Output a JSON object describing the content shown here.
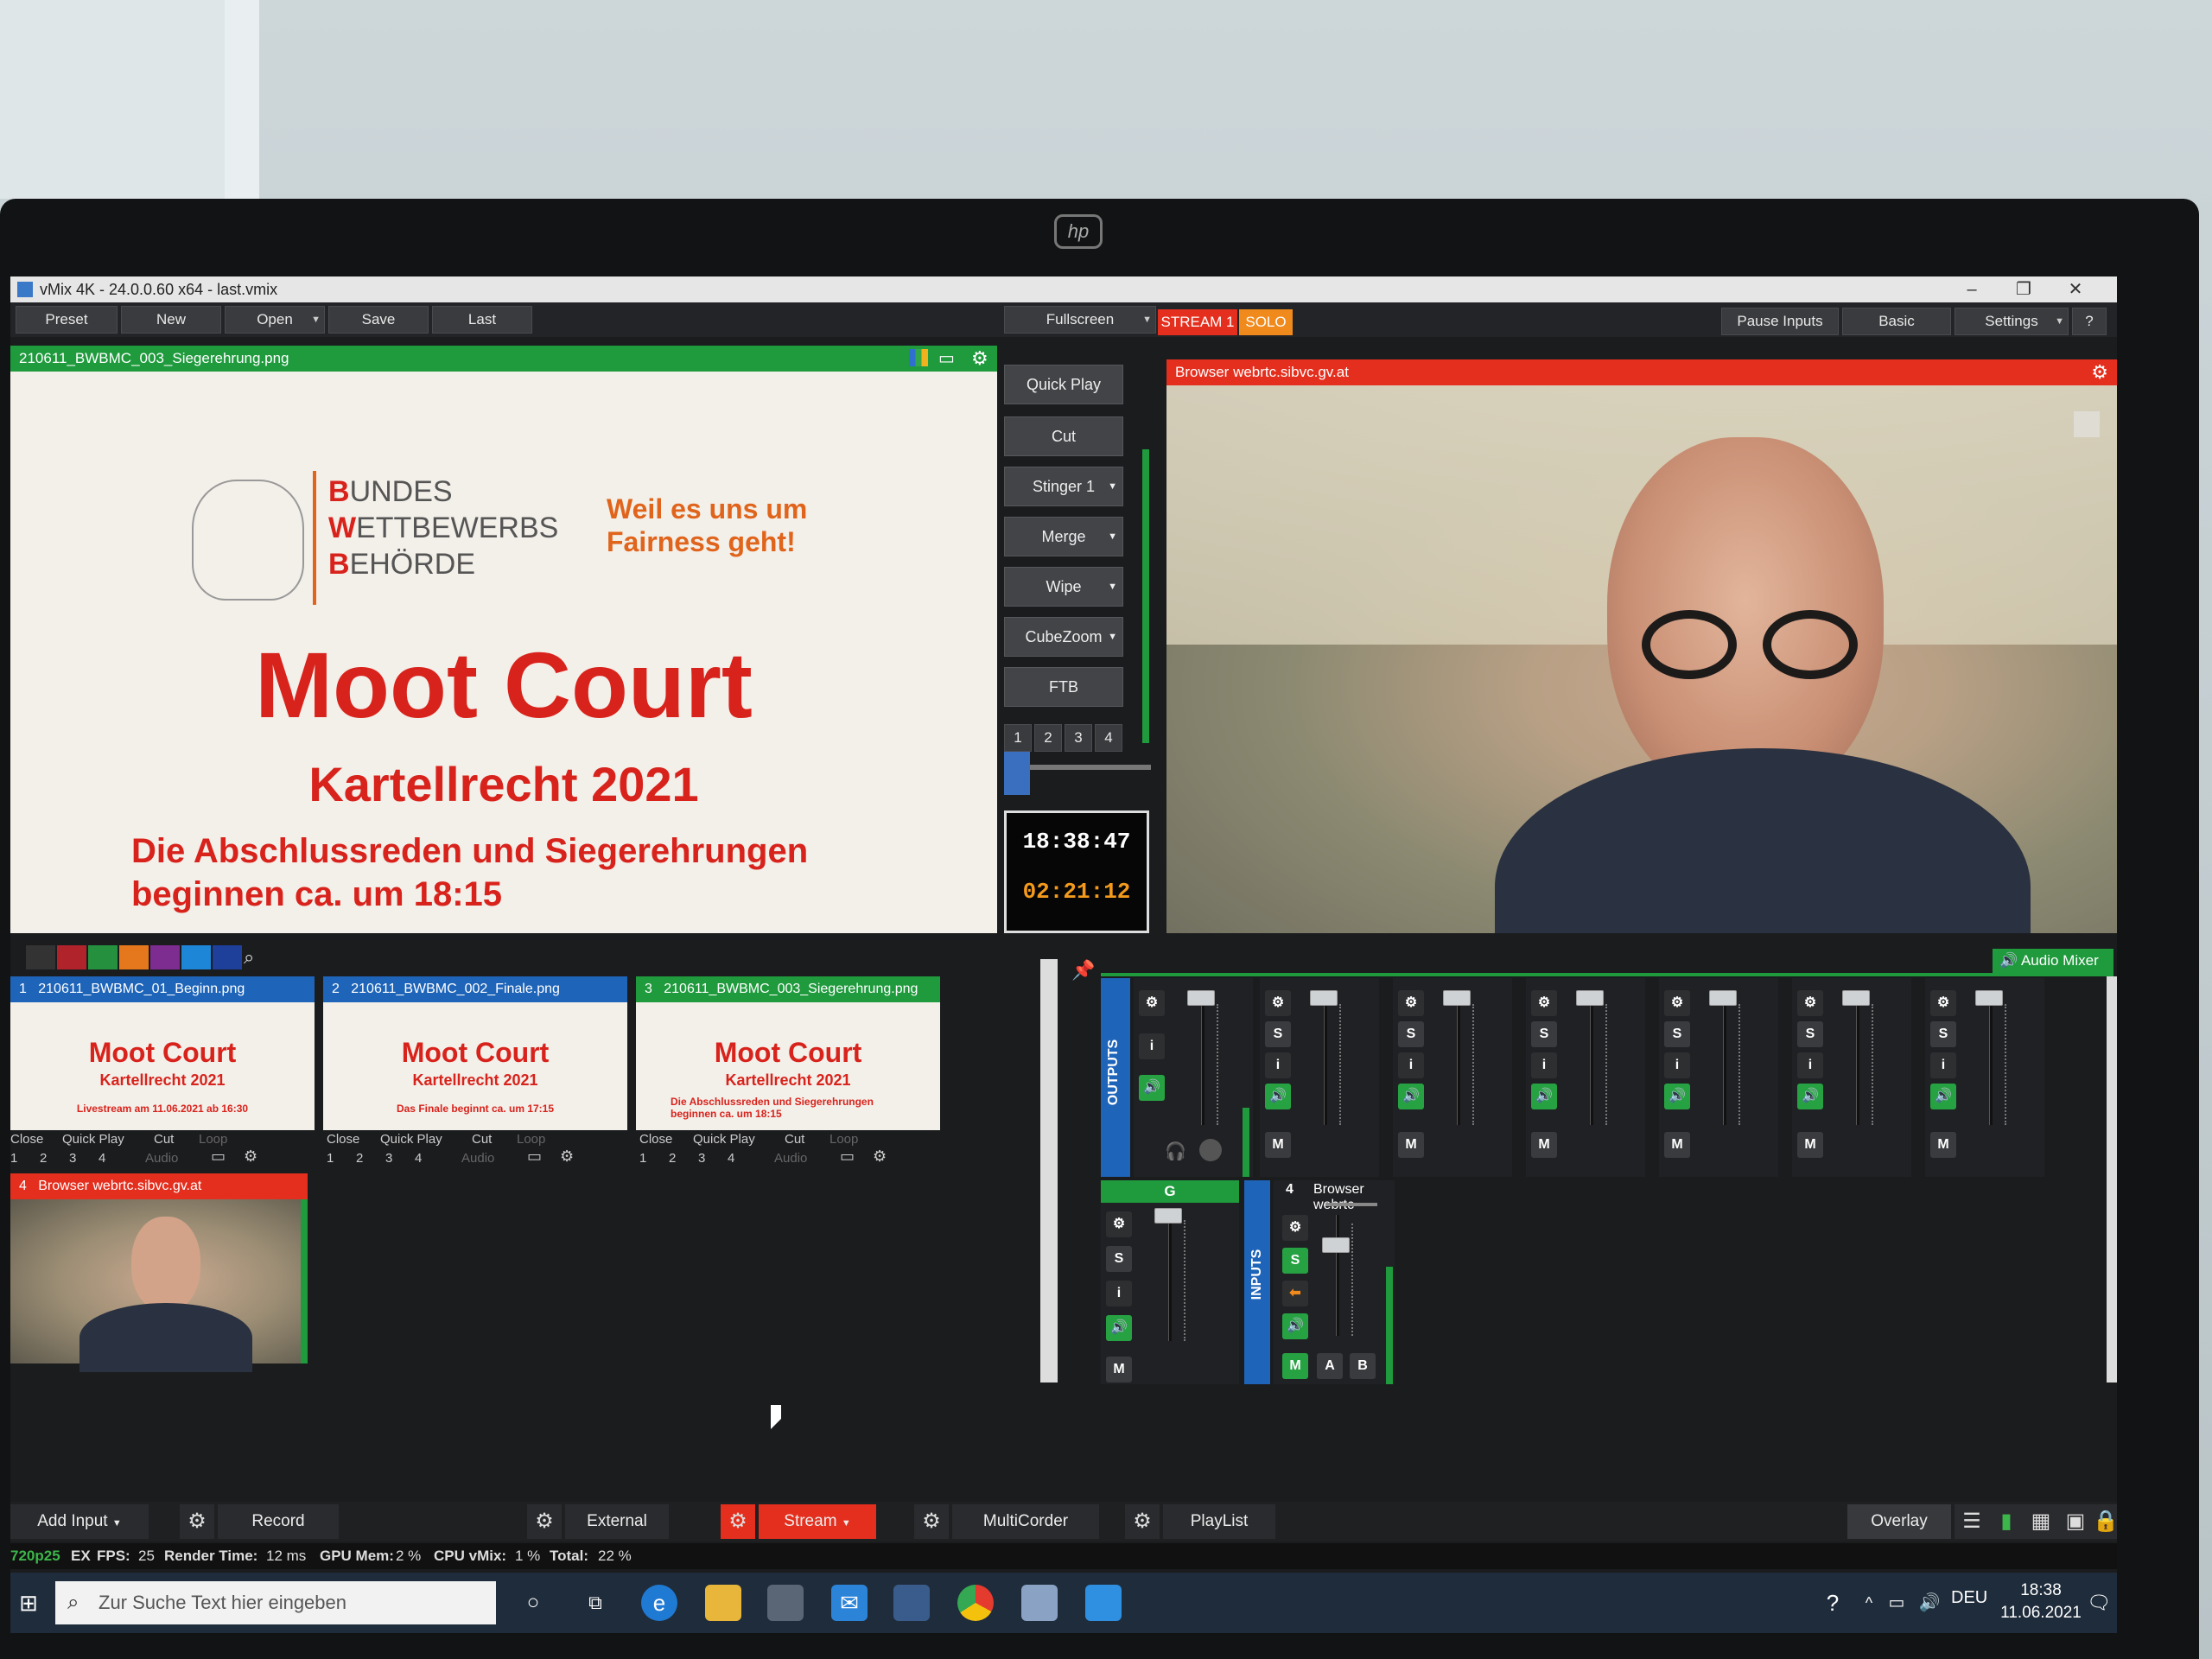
{
  "window": {
    "title": "vMix 4K - 24.0.0.60 x64 - last.vmix"
  },
  "menu": {
    "preset": "Preset",
    "new": "New",
    "open": "Open",
    "save": "Save",
    "last": "Last"
  },
  "top_right": {
    "fullscreen": "Fullscreen",
    "stream": "STREAM 1",
    "solo": "SOLO",
    "pause_inputs": "Pause Inputs",
    "basic": "Basic",
    "settings": "Settings",
    "help": "?"
  },
  "preview": {
    "header": "210611_BWBMC_003_Siegerehrung.png",
    "logo_lines": [
      "B",
      "UNDES",
      "W",
      "ETTBEWERBS",
      "B",
      "EHÖRDE"
    ],
    "slogan_line1": "Weil es uns um",
    "slogan_line2": "Fairness geht!",
    "title": "Moot Court",
    "subtitle": "Kartellrecht 2021",
    "line1": "Die Abschlussreden und Siegerehrungen",
    "line2": "beginnen ca. um 18:15"
  },
  "output": {
    "header": "Browser webrtc.sibvc.gv.at"
  },
  "transitions": {
    "quick_play": "Quick Play",
    "cut": "Cut",
    "stinger": "Stinger 1",
    "merge": "Merge",
    "wipe": "Wipe",
    "cubezoom": "CubeZoom",
    "ftb": "FTB",
    "numbers": [
      "1",
      "2",
      "3",
      "4"
    ],
    "clock": "18:38:47",
    "duration": "02:21:12"
  },
  "colors": {
    "accent_green": "#1f9a3d",
    "accent_red": "#e42f1e",
    "accent_blue": "#1e64b8",
    "orange": "#e0641b"
  },
  "inputs": [
    {
      "num": "1",
      "name": "210611_BWBMC_01_Beginn.png",
      "title": "Moot Court",
      "sub": "Kartellrecht 2021",
      "note": "Livestream am 11.06.2021 ab 16:30",
      "state": "blue"
    },
    {
      "num": "2",
      "name": "210611_BWBMC_002_Finale.png",
      "title": "Moot Court",
      "sub": "Kartellrecht 2021",
      "note": "Das Finale beginnt ca. um 17:15",
      "state": "blue"
    },
    {
      "num": "3",
      "name": "210611_BWBMC_003_Siegerehrung.png",
      "title": "Moot Court",
      "sub": "Kartellrecht 2021",
      "note": "Die Abschlussreden und Siegerehrungen beginnen ca. um 18:15",
      "state": "green"
    }
  ],
  "input4": {
    "num": "4",
    "name": "Browser webrtc.sibvc.gv.at"
  },
  "input_controls": {
    "close": "Close",
    "quick_play": "Quick Play",
    "cut": "Cut",
    "loop": "Loop",
    "audio": "Audio",
    "n1": "1",
    "n2": "2",
    "n3": "3",
    "n4": "4"
  },
  "mixer": {
    "audio_mixer": "Audio Mixer",
    "outputs": "OUTPUTS",
    "inputs": "INPUTS",
    "bus_g": "G",
    "input4_label": "4",
    "input4_name": "Browser webrtc",
    "s": "S",
    "i": "i",
    "m": "M",
    "a": "A",
    "b": "B"
  },
  "bottom": {
    "add_input": "Add Input",
    "record": "Record",
    "external": "External",
    "stream": "Stream",
    "multicorder": "MultiCorder",
    "playlist": "PlayList",
    "overlay": "Overlay"
  },
  "status": {
    "format": "720p25",
    "ex": "EX",
    "fps_label": "FPS:",
    "fps": "25",
    "render_label": "Render Time:",
    "render": "12 ms",
    "gpu_label": "GPU Mem:",
    "gpu": "2 %",
    "cpu_label": "CPU vMix:",
    "cpu": "1 %",
    "total_label": "Total:",
    "total": "22 %"
  },
  "taskbar": {
    "search_placeholder": "Zur Suche Text hier eingeben",
    "lang": "DEU",
    "time": "18:38",
    "date": "11.06.2021"
  }
}
